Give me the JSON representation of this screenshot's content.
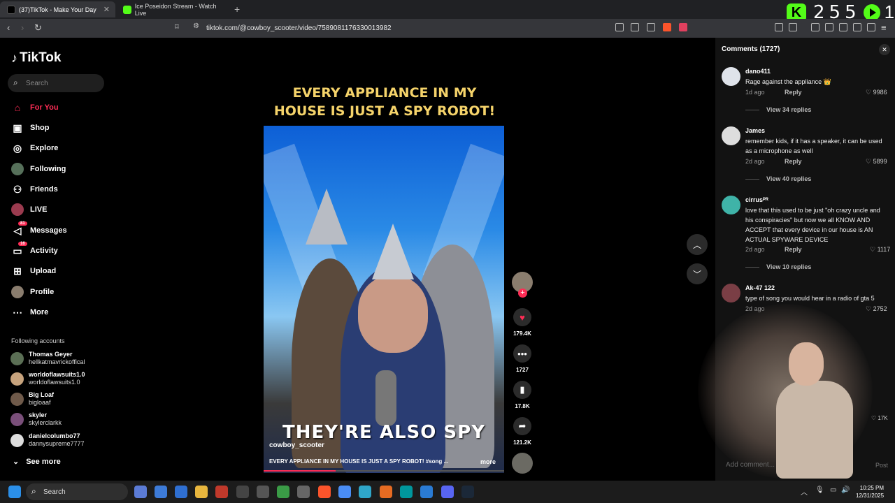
{
  "browser": {
    "tabs": [
      {
        "label": "(37)TikTok - Make Your Day",
        "close": "✕"
      },
      {
        "label": "Ice Poseidon Stream - Watch Live"
      }
    ],
    "new_tab": "+",
    "url": "tiktok.com/@cowboy_scooter/video/7589081176330013982",
    "kick_count": "255",
    "kick_extra": "1"
  },
  "sidebar": {
    "logo": "TikTok",
    "search_placeholder": "Search",
    "items": [
      {
        "label": "For You",
        "icon": "home-icon"
      },
      {
        "label": "Shop",
        "icon": "shop-icon"
      },
      {
        "label": "Explore",
        "icon": "compass-icon"
      },
      {
        "label": "Following",
        "icon": "following-icon"
      },
      {
        "label": "Friends",
        "icon": "friends-icon"
      },
      {
        "label": "LIVE",
        "icon": "live-icon"
      },
      {
        "label": "Messages",
        "icon": "messages-icon",
        "badge": "81"
      },
      {
        "label": "Activity",
        "icon": "activity-icon",
        "badge": "16"
      },
      {
        "label": "Upload",
        "icon": "upload-icon"
      },
      {
        "label": "Profile",
        "icon": "profile-icon"
      },
      {
        "label": "More",
        "icon": "more-icon"
      }
    ],
    "following_title": "Following accounts",
    "following": [
      {
        "name": "Thomas Geyer",
        "handle": "hellkatmavrickoffical"
      },
      {
        "name": "worldoflawsuits1.0",
        "handle": "worldoflawsuits1.0"
      },
      {
        "name": "Big Loaf",
        "handle": "bigloaaf"
      },
      {
        "name": "skyler",
        "handle": "skylerclarkk"
      },
      {
        "name": "danielcolumbo77",
        "handle": "dannysupreme7777"
      }
    ],
    "see_more": "See more"
  },
  "video": {
    "title_line1": "EVERY APPLIANCE IN MY",
    "title_line2": "HOUSE IS JUST A SPY ROBOT!",
    "subtitle": "THEY'RE ALSO SPY",
    "creator": "cowboy_scooter",
    "description": "EVERY APPLIANCE IN MY HOUSE IS JUST A SPY ROBOT! #song ...",
    "more": "more",
    "progress": 0.3
  },
  "actions": {
    "likes": "179.4K",
    "comments": "1727",
    "saves": "17.8K",
    "shares": "121.2K"
  },
  "comments_panel": {
    "header": "Comments (1727)",
    "items": [
      {
        "user": "dano411",
        "text": "Rage against the appliance 👑",
        "time": "1d ago",
        "reply": "Reply",
        "likes": "9986",
        "view": "View 34 replies"
      },
      {
        "user": "James",
        "text": "remember kids, if it has a speaker, it can be used as a microphone as well",
        "time": "2d ago",
        "reply": "Reply",
        "likes": "5899",
        "view": "View 40 replies"
      },
      {
        "user": "cirrusᴾᴿ",
        "text": "love that this used to be just \"oh crazy uncle and his conspiracies\" but now we all KNOW AND ACCEPT that every device in our house is AN ACTUAL SPYWARE DEVICE",
        "time": "2d ago",
        "reply": "Reply",
        "likes": "1117",
        "view": "View 10 replies"
      },
      {
        "user": "Ak-47 122",
        "text": "type of song you would hear in a radio of gta 5",
        "time": "2d ago",
        "reply": "",
        "likes": "2752",
        "view": ""
      }
    ],
    "extra_likes": "17K",
    "add_placeholder": "Add comment...",
    "post": "Post"
  },
  "taskbar": {
    "search": "Search",
    "time": "10:25 PM",
    "date": "12/31/2025"
  },
  "colors": {
    "accent": "#fe2c55",
    "kick": "#53fc18",
    "title": "#f5d36a"
  }
}
